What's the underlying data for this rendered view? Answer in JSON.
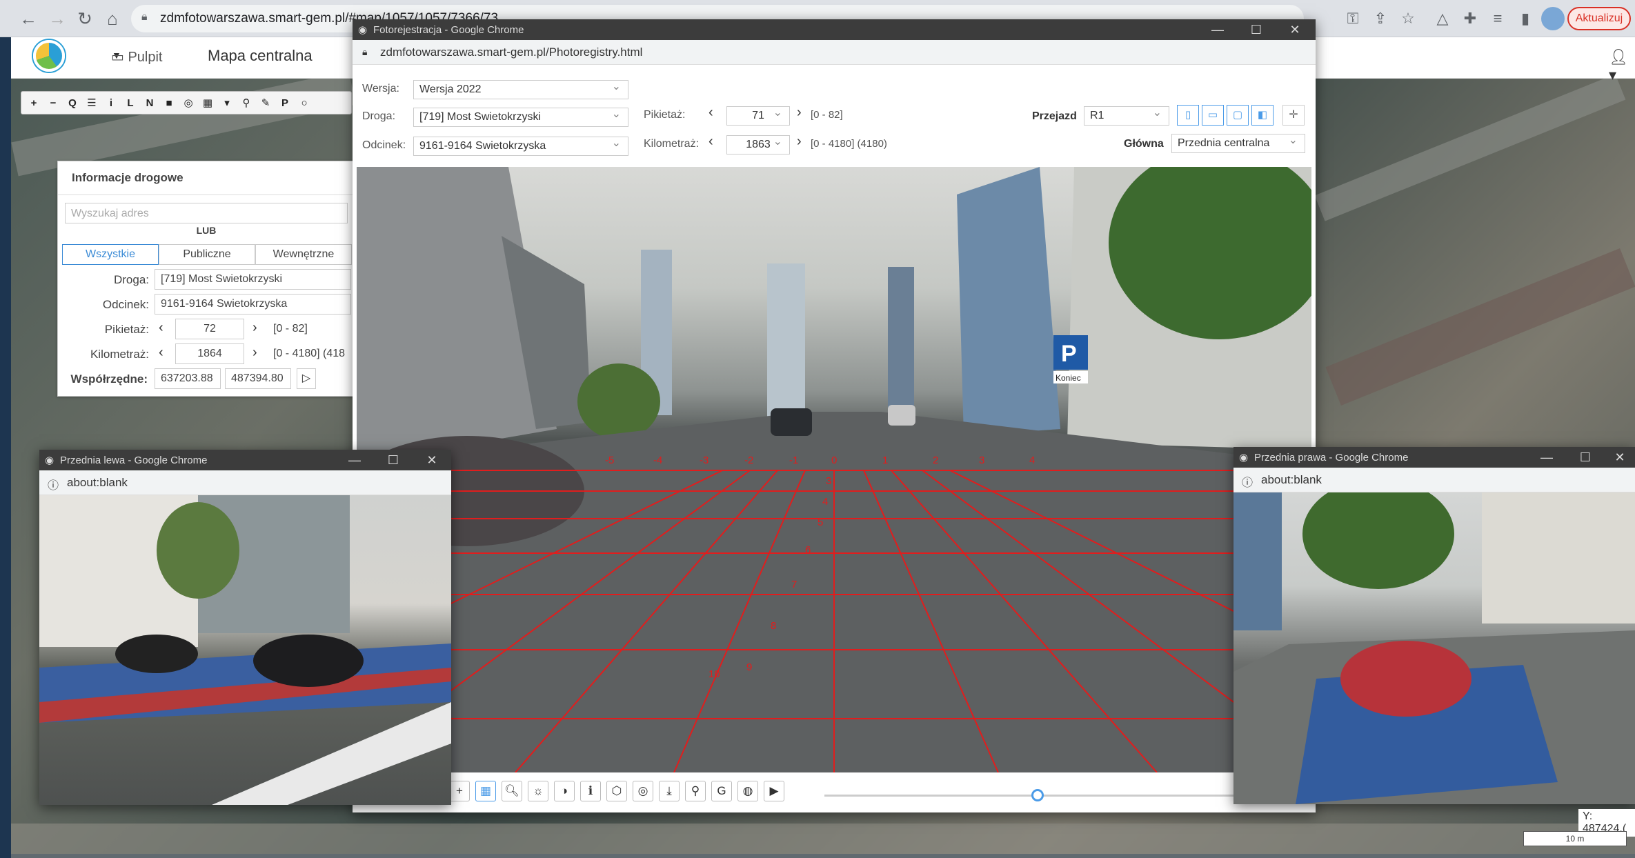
{
  "browser": {
    "url": "zdmfotowarszawa.smart-gem.pl/#map/1057/1057/7366/73",
    "update_label": "Aktualizuj"
  },
  "app": {
    "pulpit_label": "Pulpit",
    "title": "Mapa centralna"
  },
  "map_toolbar": [
    "+",
    "−",
    "Q",
    "☰",
    "i",
    "L",
    "N",
    "■",
    "◎",
    "▦",
    "▾",
    "⚲",
    "✎",
    "P",
    "○"
  ],
  "info_panel": {
    "title": "Informacje drogowe",
    "search_placeholder": "Wyszukaj adres",
    "lub": "LUB",
    "tabs": [
      "Wszystkie",
      "Publiczne",
      "Wewnętrzne"
    ],
    "droga_label": "Droga:",
    "droga_value": "[719] Most Swietokrzyski",
    "odcinek_label": "Odcinek:",
    "odcinek_value": "9161-9164 Swietokrzyska",
    "pikietaz_label": "Pikietaż:",
    "pikietaz_value": "72",
    "pikietaz_range": "[0 - 82]",
    "kilometraz_label": "Kilometraż:",
    "kilometraz_value": "1864",
    "kilometraz_range": "[0 - 4180] (418",
    "wspolrzedne_label": "Współrzędne:",
    "coord_x": "637203.88",
    "coord_y": "487394.80"
  },
  "main_window": {
    "title": "Fotorejestracja - Google Chrome",
    "address": "zdmfotowarszawa.smart-gem.pl/Photoregistry.html",
    "wersja_label": "Wersja:",
    "wersja_value": "Wersja 2022",
    "droga_label": "Droga:",
    "droga_value": "[719] Most Swietokrzyski",
    "odcinek_label": "Odcinek:",
    "odcinek_value": "9161-9164 Swietokrzyska",
    "pikietaz_label": "Pikietaż:",
    "pikietaz_value": "71",
    "pikietaz_range": "[0 - 82]",
    "kilometraz_label": "Kilometraż:",
    "kilometraz_value": "1863",
    "kilometraz_range": "[0 - 4180] (4180)",
    "przejazd_label": "Przejazd",
    "przejazd_value": "R1",
    "glowna_label": "Główna",
    "glowna_value": "Przednia centralna",
    "grid_labels": [
      "-5",
      "-4",
      "-3",
      "-2",
      "-1",
      "0",
      "1",
      "2",
      "3",
      "4",
      "3",
      "4",
      "5",
      "6",
      "7",
      "8",
      "9",
      "10"
    ],
    "sign_text": "Koniec"
  },
  "left_window": {
    "title": "Przednia lewa - Google Chrome",
    "address": "about:blank"
  },
  "right_window": {
    "title": "Przednia prawa - Google Chrome",
    "address": "about:blank"
  },
  "status": {
    "coord_y": "Y: 487424.(",
    "scale": "10 m"
  }
}
